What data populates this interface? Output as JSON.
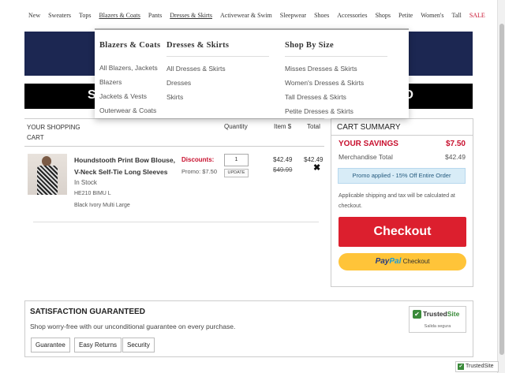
{
  "nav": {
    "items": [
      "New",
      "Sweaters",
      "Tops",
      "Blazers & Coats",
      "Pants",
      "Dresses & Skirts",
      "Activewear & Swim",
      "Sleepwear",
      "Shoes",
      "Accessories",
      "Shops",
      "Petite",
      "Women's",
      "Tall",
      "SALE"
    ]
  },
  "banner": {
    "left_fragment": "S",
    "right_fragment": "O"
  },
  "dropdown": {
    "col1": {
      "title": "Blazers & Coats",
      "items": [
        "All Blazers, Jackets",
        "Blazers",
        "Jackets & Vests",
        "Outerwear & Coats"
      ]
    },
    "col2": {
      "title": "Dresses & Skirts",
      "items": [
        "All Dresses & Skirts",
        "Dresses",
        "Skirts"
      ]
    },
    "col3": {
      "title": "Shop By Size",
      "items": [
        "Misses Dresses & Skirts",
        "Women's Dresses & Skirts",
        "Tall Dresses & Skirts",
        "Petite Dresses & Skirts"
      ]
    }
  },
  "cart": {
    "title": "YOUR SHOPPING CART",
    "headers": {
      "quantity": "Quantity",
      "item_price": "Item $",
      "total": "Total"
    },
    "item": {
      "name": "Houndstooth Print Bow Blouse, V-Neck Self-Tie Long Sleeves",
      "stock": "In Stock",
      "sku": "HE210 BIMU L",
      "color": "Black Ivory Multi Large",
      "discounts_label": "Discounts:",
      "promo": "Promo: $7.50",
      "quantity": "1",
      "update_label": "UPDATE",
      "price": "$42.49",
      "original_price": "$49.99",
      "total": "$42.49",
      "remove": "✖"
    }
  },
  "summary": {
    "title": "CART SUMMARY",
    "savings_label": "YOUR SAVINGS",
    "savings_value": "$7.50",
    "merch_label": "Merchandise Total",
    "merch_value": "$42.49",
    "promo_applied": "Promo applied - 15% Off Entire Order",
    "shipping_note": "Applicable shipping and tax will be calculated at checkout.",
    "checkout_label": "Checkout",
    "paypal_part1": "Pay",
    "paypal_part2": "Pal",
    "paypal_suffix": "Checkout"
  },
  "satisfaction": {
    "title": "SATISFACTION GUARANTEED",
    "text": "Shop worry-free with our unconditional guarantee on every purchase.",
    "tabs": [
      "Guarantee",
      "Easy Returns",
      "Security"
    ]
  },
  "trusted_site": {
    "name_part1": "Trusted",
    "name_part2": "Site",
    "subtitle": "Salida segura",
    "corner_label": "TrustedSite"
  },
  "colors": {
    "accent_red": "#dc1f2e",
    "navy": "#1c2752",
    "paypal_yellow": "#ffc439",
    "promo_blue": "#d8ecf7"
  }
}
